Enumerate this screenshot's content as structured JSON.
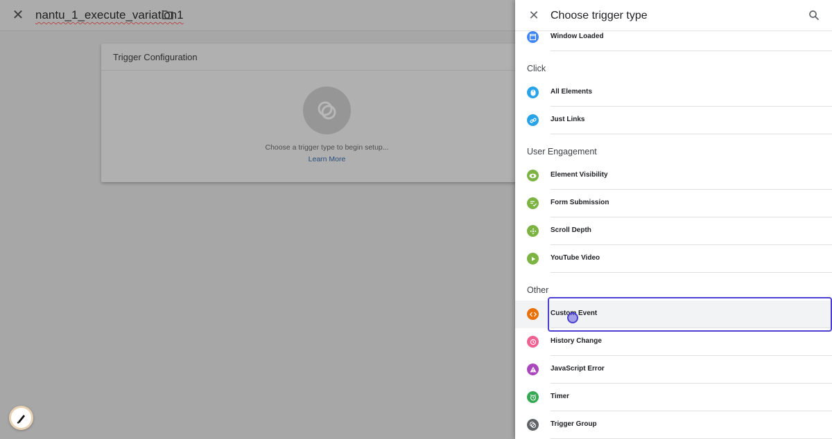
{
  "topbar": {
    "title": "nantu_1_execute_variation1"
  },
  "card": {
    "heading": "Trigger Configuration",
    "hint": "Choose a trigger type to begin setup...",
    "link": "Learn More"
  },
  "panel": {
    "title": "Choose trigger type",
    "top_item": {
      "label": "Window Loaded",
      "icon": "window-icon",
      "color": "#4285f4"
    },
    "sections": [
      {
        "title": "Click",
        "items": [
          {
            "label": "All Elements",
            "icon": "mouse-icon",
            "color": "#29a3e8"
          },
          {
            "label": "Just Links",
            "icon": "link-icon",
            "color": "#29a3e8"
          }
        ]
      },
      {
        "title": "User Engagement",
        "items": [
          {
            "label": "Element Visibility",
            "icon": "eye-icon",
            "color": "#7cb342"
          },
          {
            "label": "Form Submission",
            "icon": "form-icon",
            "color": "#7cb342"
          },
          {
            "label": "Scroll Depth",
            "icon": "move-icon",
            "color": "#7cb342"
          },
          {
            "label": "YouTube Video",
            "icon": "play-icon",
            "color": "#7cb342"
          }
        ]
      },
      {
        "title": "Other",
        "items": [
          {
            "label": "Custom Event",
            "icon": "code-icon",
            "color": "#e8710a"
          },
          {
            "label": "History Change",
            "icon": "history-icon",
            "color": "#f06292"
          },
          {
            "label": "JavaScript Error",
            "icon": "warning-icon",
            "color": "#ab47bc"
          },
          {
            "label": "Timer",
            "icon": "alarm-icon",
            "color": "#34a853"
          },
          {
            "label": "Trigger Group",
            "icon": "group-icon",
            "color": "#5f6368"
          }
        ]
      }
    ]
  }
}
